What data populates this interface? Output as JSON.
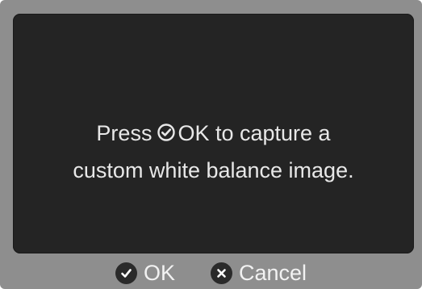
{
  "dialog": {
    "line1_before": "Press",
    "line1_after": "OK to capture a",
    "line2": "custom white balance image.",
    "inline_icon": "checkmark-circle-icon"
  },
  "buttons": {
    "ok_label": "OK",
    "ok_icon": "checkmark-icon",
    "cancel_label": "Cancel",
    "cancel_icon": "x-icon"
  },
  "colors": {
    "screen_bg": "#242424",
    "frame_bg": "#8e8e8e",
    "text": "#e8e8e8"
  }
}
